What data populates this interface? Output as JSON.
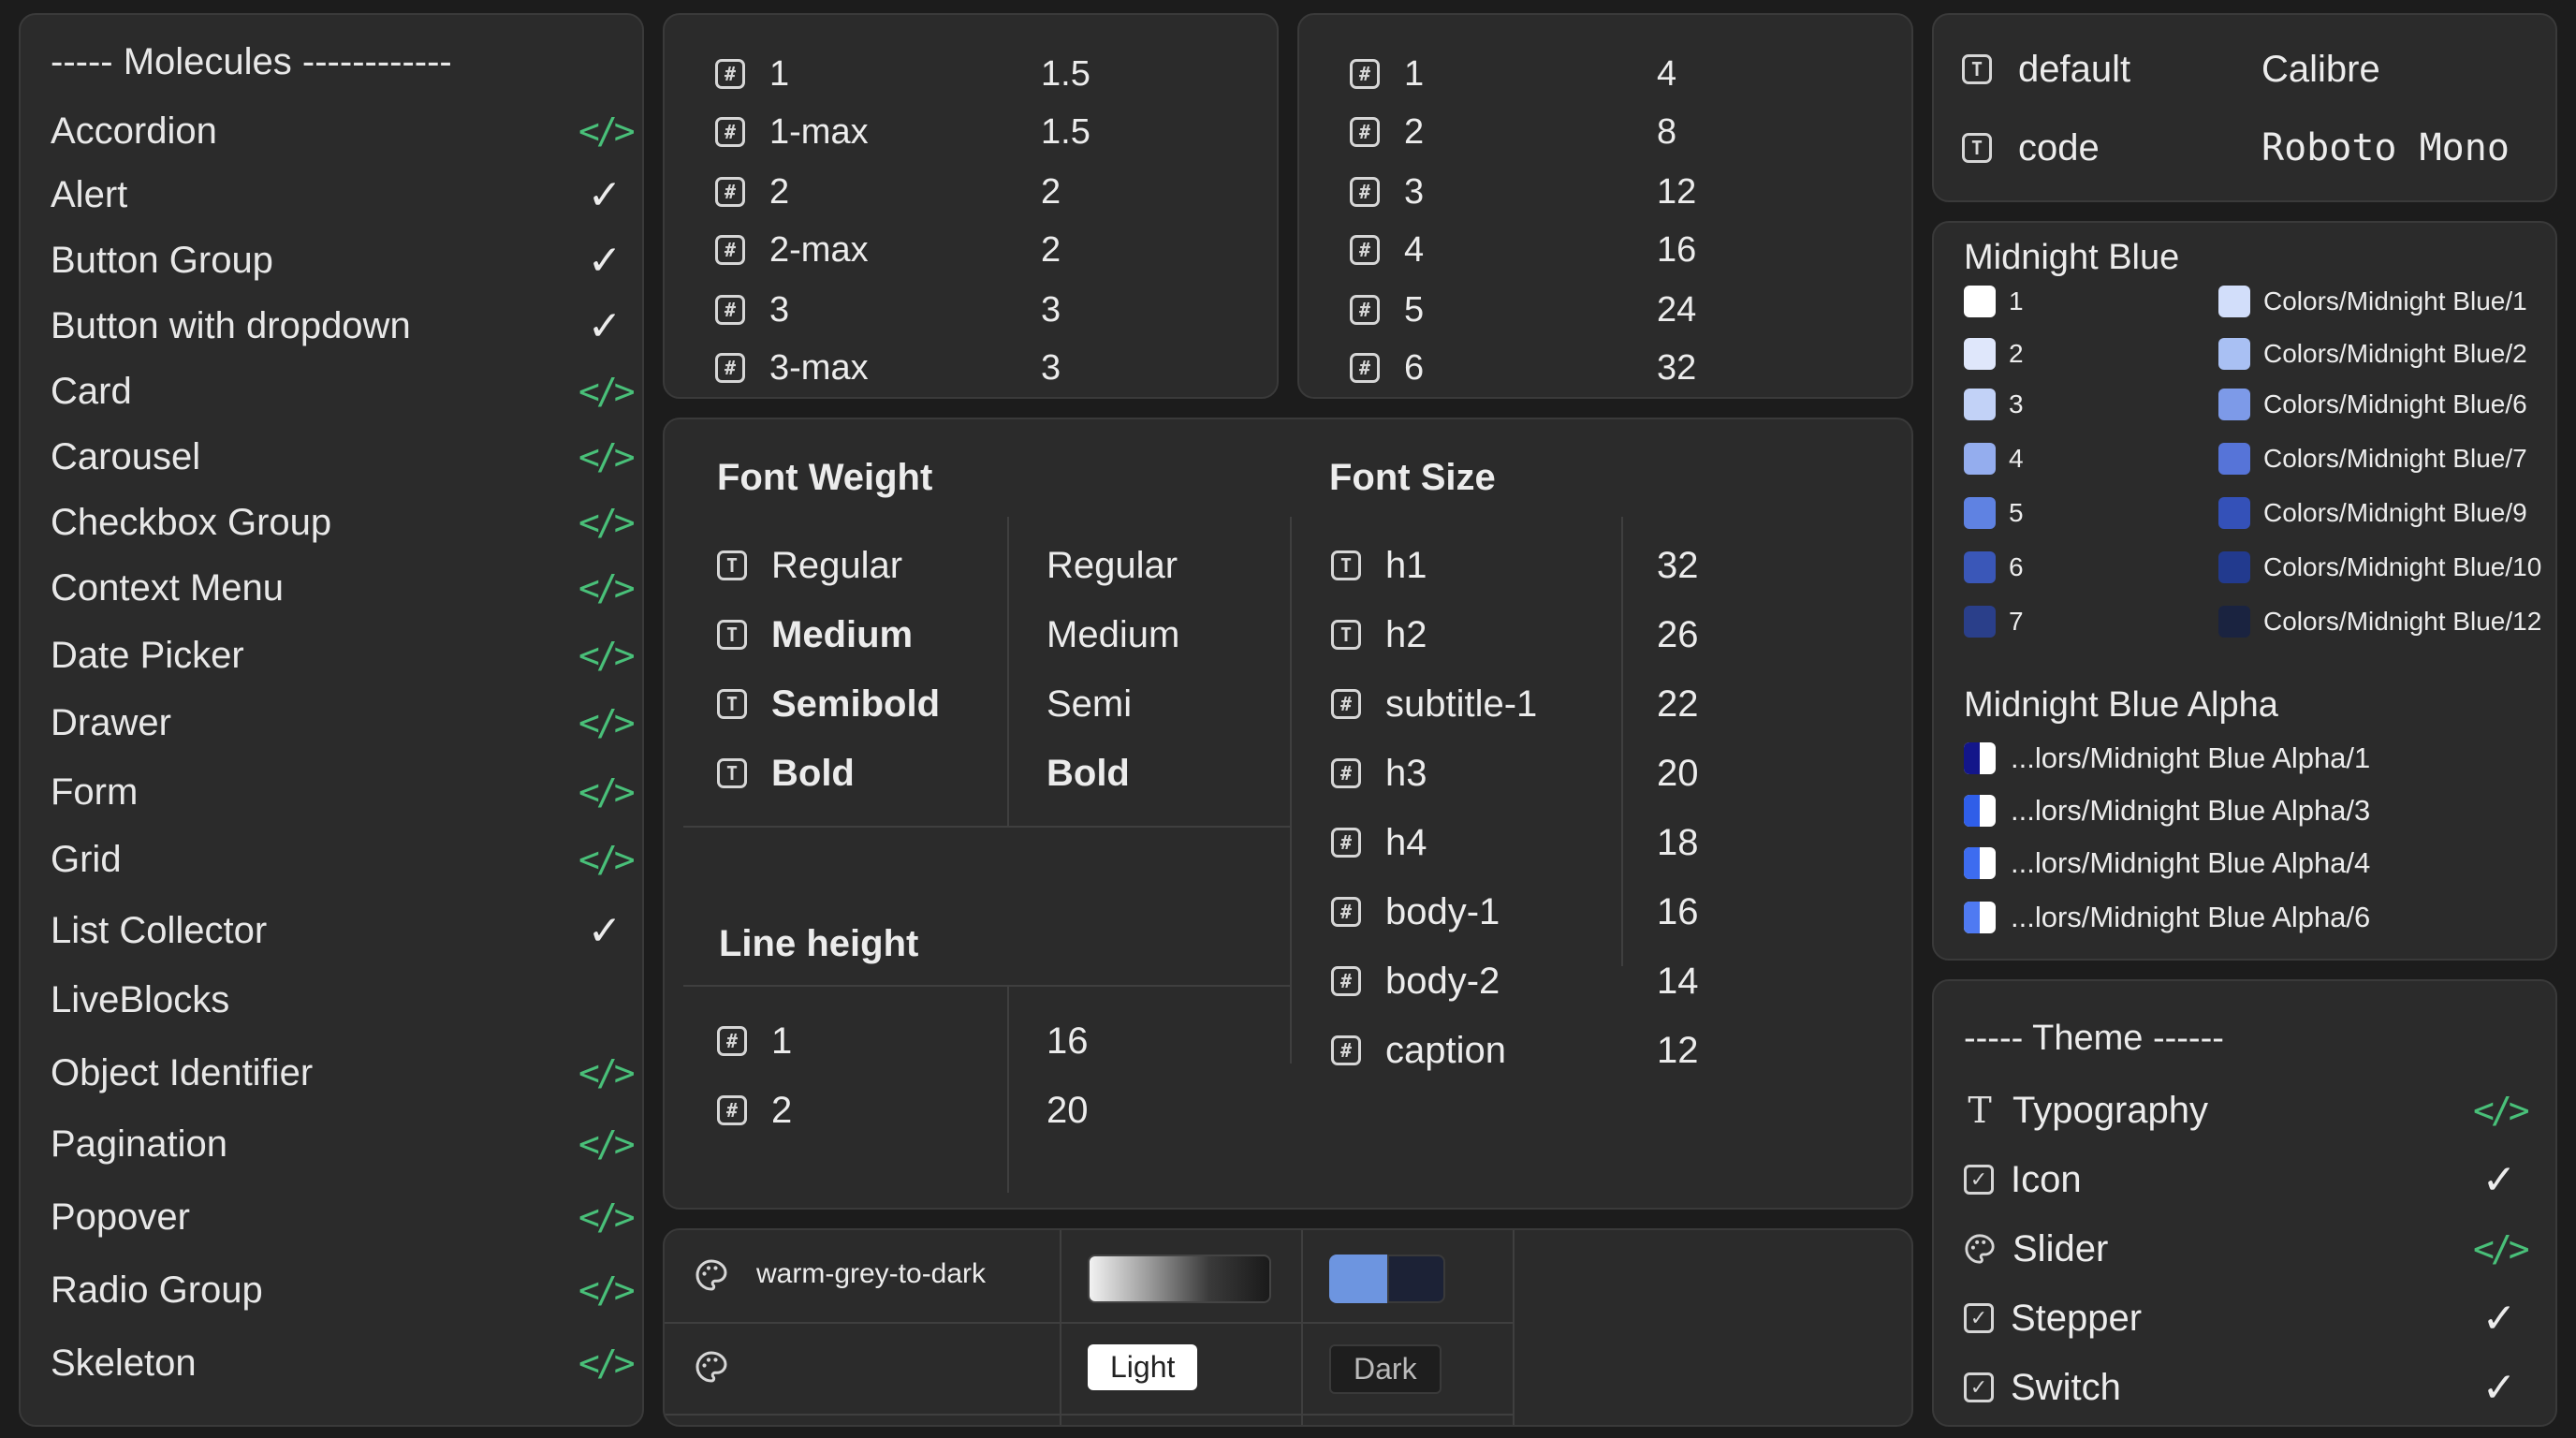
{
  "molecules": {
    "header": "----- Molecules ------------",
    "items": [
      {
        "label": "Accordion",
        "status": "code"
      },
      {
        "label": "Alert",
        "status": "check"
      },
      {
        "label": "Button Group",
        "status": "check"
      },
      {
        "label": "Button with dropdown",
        "status": "check"
      },
      {
        "label": "Card",
        "status": "code"
      },
      {
        "label": "Carousel",
        "status": "code"
      },
      {
        "label": "Checkbox Group",
        "status": "code"
      },
      {
        "label": "Context Menu",
        "status": "code"
      },
      {
        "label": "Date Picker",
        "status": "code"
      },
      {
        "label": "Drawer",
        "status": "code"
      },
      {
        "label": "Form",
        "status": "code"
      },
      {
        "label": "Grid",
        "status": "code"
      },
      {
        "label": "List Collector",
        "status": "check"
      },
      {
        "label": "LiveBlocks",
        "status": "none"
      },
      {
        "label": "Object Identifier",
        "status": "code"
      },
      {
        "label": "Pagination",
        "status": "code"
      },
      {
        "label": "Popover",
        "status": "code"
      },
      {
        "label": "Radio Group",
        "status": "code"
      },
      {
        "label": "Skeleton",
        "status": "code"
      }
    ]
  },
  "icons": {
    "code": "</>",
    "check": "✓",
    "hash": "#",
    "text": "T",
    "checkbox": "✓"
  },
  "table1": [
    {
      "key": "1",
      "value": "1.5"
    },
    {
      "key": "1-max",
      "value": "1.5"
    },
    {
      "key": "2",
      "value": "2"
    },
    {
      "key": "2-max",
      "value": "2"
    },
    {
      "key": "3",
      "value": "3"
    },
    {
      "key": "3-max",
      "value": "3"
    }
  ],
  "table2": [
    {
      "key": "1",
      "value": "4"
    },
    {
      "key": "2",
      "value": "8"
    },
    {
      "key": "3",
      "value": "12"
    },
    {
      "key": "4",
      "value": "16"
    },
    {
      "key": "5",
      "value": "24"
    },
    {
      "key": "6",
      "value": "32"
    }
  ],
  "typography": {
    "font_weight_title": "Font Weight",
    "font_weight": [
      {
        "key": "Regular",
        "value": "Regular"
      },
      {
        "key": "Medium",
        "value": "Medium"
      },
      {
        "key": "Semibold",
        "value": "Semi"
      },
      {
        "key": "Bold",
        "value": "Bold"
      }
    ],
    "line_height_title": "Line height",
    "line_height": [
      {
        "key": "1",
        "value": "16"
      },
      {
        "key": "2",
        "value": "20"
      }
    ],
    "font_size_title": "Font Size",
    "font_size": [
      {
        "key": "h1",
        "value": "32",
        "icon": "text"
      },
      {
        "key": "h2",
        "value": "26",
        "icon": "text"
      },
      {
        "key": "subtitle-1",
        "value": "22",
        "icon": "hash"
      },
      {
        "key": "h3",
        "value": "20",
        "icon": "hash"
      },
      {
        "key": "h4",
        "value": "18",
        "icon": "hash"
      },
      {
        "key": "body-1",
        "value": "16",
        "icon": "hash"
      },
      {
        "key": "body-2",
        "value": "14",
        "icon": "hash"
      },
      {
        "key": "caption",
        "value": "12",
        "icon": "hash"
      }
    ]
  },
  "gradients": {
    "row1_label": "warm-grey-to-dark",
    "light_label": "Light",
    "dark_label": "Dark",
    "light_gradient": [
      "#f2f2f2",
      "#9a9a9a",
      "#3a3a3a",
      "#1a1a1a"
    ],
    "swatch_blue": "#6d95e0",
    "swatch_dark": "#1c2236"
  },
  "fonts": [
    {
      "key": "default",
      "value": "Calibre"
    },
    {
      "key": "code",
      "value": "Roboto Mono"
    }
  ],
  "colors": {
    "midnight_title": "Midnight Blue",
    "midnight_left": [
      {
        "label": "1",
        "color": "#ffffff"
      },
      {
        "label": "2",
        "color": "#dfe7fb"
      },
      {
        "label": "3",
        "color": "#c2d2f7"
      },
      {
        "label": "4",
        "color": "#94adee"
      },
      {
        "label": "5",
        "color": "#5f82e2"
      },
      {
        "label": "6",
        "color": "#3a57b8"
      },
      {
        "label": "7",
        "color": "#2a3f8a"
      }
    ],
    "midnight_right": [
      {
        "label": "Colors/Midnight Blue/1",
        "color": "#d2defa"
      },
      {
        "label": "Colors/Midnight Blue/2",
        "color": "#a9c0f3"
      },
      {
        "label": "Colors/Midnight Blue/6",
        "color": "#7d9ae8"
      },
      {
        "label": "Colors/Midnight Blue/7",
        "color": "#5674d8"
      },
      {
        "label": "Colors/Midnight Blue/9",
        "color": "#3451b8"
      },
      {
        "label": "Colors/Midnight Blue/10",
        "color": "#223a8e"
      },
      {
        "label": "Colors/Midnight Blue/12",
        "color": "#1a2340"
      }
    ],
    "alpha_title": "Midnight Blue Alpha",
    "alpha": [
      {
        "label": "...lors/Midnight Blue Alpha/1",
        "color": "#13168a"
      },
      {
        "label": "...lors/Midnight Blue Alpha/3",
        "color": "#2f5ee8"
      },
      {
        "label": "...lors/Midnight Blue Alpha/4",
        "color": "#3d6cf0"
      },
      {
        "label": "...lors/Midnight Blue Alpha/6",
        "color": "#4f7af2"
      }
    ]
  },
  "theme": {
    "header": "----- Theme ------",
    "items": [
      {
        "label": "Typography",
        "icon": "text",
        "status": "code"
      },
      {
        "label": "Icon",
        "icon": "checkbox",
        "status": "check"
      },
      {
        "label": "Slider",
        "icon": "palette",
        "status": "code"
      },
      {
        "label": "Stepper",
        "icon": "checkbox",
        "status": "check"
      },
      {
        "label": "Switch",
        "icon": "checkbox",
        "status": "check"
      }
    ]
  },
  "accent_green": "#49c079"
}
